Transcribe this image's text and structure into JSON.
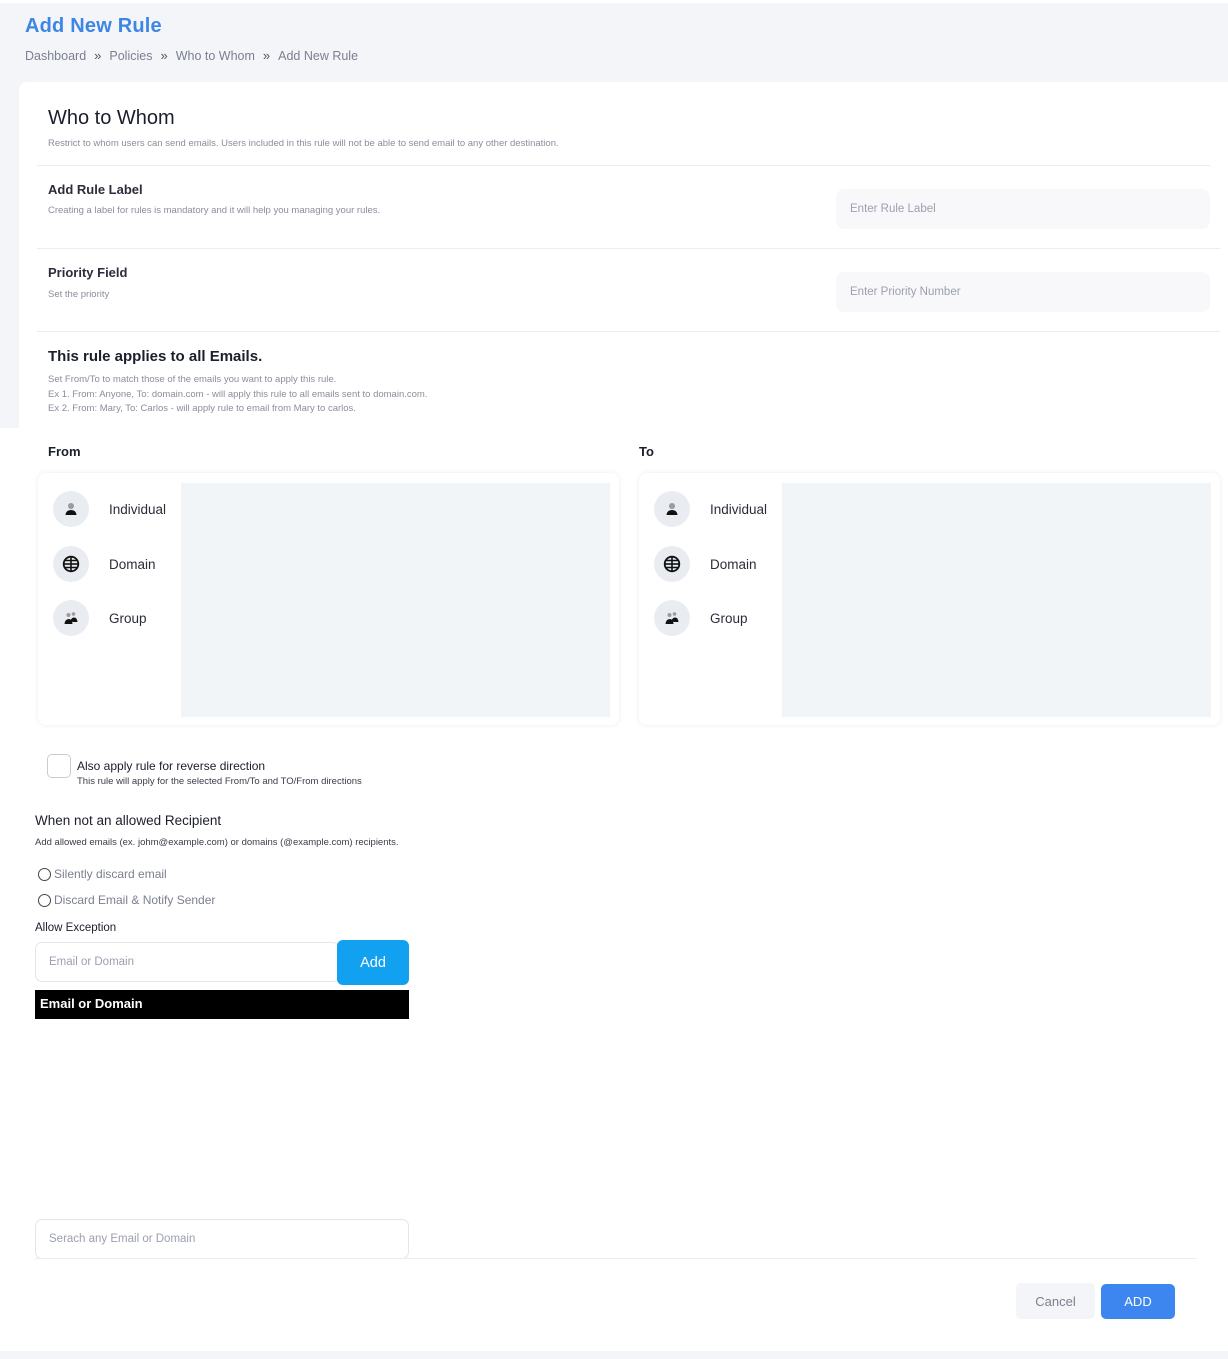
{
  "header": {
    "title": "Add New Rule",
    "breadcrumb": [
      "Dashboard",
      "Policies",
      "Who to Whom",
      "Add New Rule"
    ],
    "breadcrumb_separator": "»"
  },
  "section": {
    "title": "Who to Whom",
    "description": "Restrict to whom users can send emails. Users included in this rule will not be able to send email to any other destination."
  },
  "rule_label": {
    "label": "Add Rule Label",
    "description": "Creating a label for rules is mandatory and it will help you managing your rules.",
    "placeholder": "Enter Rule Label",
    "value": ""
  },
  "priority": {
    "label": "Priority Field",
    "description": "Set the priority",
    "placeholder": "Enter Priority Number",
    "value": ""
  },
  "applies": {
    "title": "This rule applies to all Emails.",
    "lines": [
      "Set From/To to match those of the emails you want to apply this rule.",
      "Ex 1. From: Anyone, To: domain.com - will apply this rule to all emails sent to domain.com.",
      "Ex 2. From: Mary, To: Carlos - will apply rule to email from Mary to carlos."
    ]
  },
  "from": {
    "label": "From",
    "options": [
      {
        "label": "Individual",
        "icon": "person-icon"
      },
      {
        "label": "Domain",
        "icon": "globe-icon"
      },
      {
        "label": "Group",
        "icon": "group-icon"
      }
    ]
  },
  "to": {
    "label": "To",
    "options": [
      {
        "label": "Individual",
        "icon": "person-icon"
      },
      {
        "label": "Domain",
        "icon": "globe-icon"
      },
      {
        "label": "Group",
        "icon": "group-icon"
      }
    ]
  },
  "reverse": {
    "checked": false,
    "label": "Also apply rule for reverse direction",
    "description": "This rule will apply for the selected From/To and TO/From directions"
  },
  "not_allowed": {
    "title": "When not an allowed Recipient",
    "description": "Add allowed emails (ex. johm@example.com) or domains (@example.com) recipients.",
    "options": [
      {
        "label": "Silently discard email",
        "selected": false
      },
      {
        "label": "Discard Email & Notify Sender",
        "selected": false
      }
    ]
  },
  "exception": {
    "label": "Allow Exception",
    "placeholder": "Email or Domain",
    "value": "",
    "add_label": "Add",
    "table_header": "Email or Domain",
    "rows": []
  },
  "search": {
    "placeholder": "Serach any Email or Domain",
    "value": ""
  },
  "footer": {
    "cancel_label": "Cancel",
    "add_label": "ADD"
  },
  "colors": {
    "accent": "#3d86e6",
    "add_exception_button": "#12a0f0",
    "primary_button": "#3d86ef",
    "page_bg": "#f3f5f9"
  }
}
